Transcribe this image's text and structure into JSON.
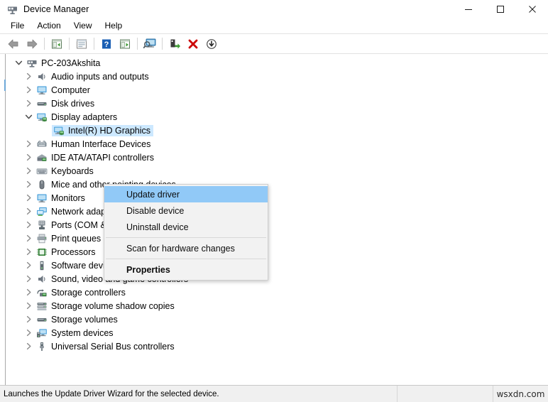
{
  "window": {
    "title": "Device Manager",
    "icon": "device-manager-icon",
    "minimize_label": "—",
    "maximize_label": "□",
    "close_label": "✕"
  },
  "menubar": {
    "items": [
      {
        "label": "File",
        "name": "menu-file"
      },
      {
        "label": "Action",
        "name": "menu-action"
      },
      {
        "label": "View",
        "name": "menu-view"
      },
      {
        "label": "Help",
        "name": "menu-help"
      }
    ]
  },
  "toolbar": {
    "buttons": [
      {
        "name": "back-button",
        "icon": "back-arrow-icon"
      },
      {
        "name": "forward-button",
        "icon": "forward-arrow-icon"
      },
      {
        "name": "show-hide-console-tree-button",
        "icon": "console-tree-icon"
      },
      {
        "name": "properties-button",
        "icon": "properties-window-icon"
      },
      {
        "name": "help-button",
        "icon": "question-mark-icon"
      },
      {
        "name": "scan-hardware-changes-button",
        "icon": "scan-list-icon"
      },
      {
        "name": "update-driver-button",
        "icon": "monitor-search-icon"
      },
      {
        "name": "enable-device-button",
        "icon": "enable-device-green-icon"
      },
      {
        "name": "uninstall-device-button",
        "icon": "red-x-icon"
      },
      {
        "name": "disable-device-button",
        "icon": "down-arrow-circle-icon"
      }
    ]
  },
  "tree": {
    "nodes": [
      {
        "label": "PC-203Akshita",
        "depth": 0,
        "state": "expanded",
        "icon": "computer-root-icon",
        "name": "tree-node-pc-203akshita"
      },
      {
        "label": "Audio inputs and outputs",
        "depth": 1,
        "state": "collapsed",
        "icon": "speaker-icon",
        "name": "tree-node-audio-inputs-and-outputs"
      },
      {
        "label": "Computer",
        "depth": 1,
        "state": "collapsed",
        "icon": "monitor-icon",
        "name": "tree-node-computer"
      },
      {
        "label": "Disk drives",
        "depth": 1,
        "state": "collapsed",
        "icon": "disk-drive-icon",
        "name": "tree-node-disk-drives"
      },
      {
        "label": "Display adapters",
        "depth": 1,
        "state": "expanded",
        "icon": "display-adapter-icon",
        "name": "tree-node-display-adapters"
      },
      {
        "label": "Intel(R) HD Graphics",
        "depth": 2,
        "state": "leaf",
        "icon": "display-adapter-icon",
        "name": "tree-node-intel-hd-graphics",
        "selected": true
      },
      {
        "label": "Human Interface Devices",
        "depth": 1,
        "state": "collapsed",
        "icon": "hid-icon",
        "name": "tree-node-human-interface-devices"
      },
      {
        "label": "IDE ATA/ATAPI controllers",
        "depth": 1,
        "state": "collapsed",
        "icon": "ide-controller-icon",
        "name": "tree-node-ide-ata-atapi-controllers"
      },
      {
        "label": "Keyboards",
        "depth": 1,
        "state": "collapsed",
        "icon": "keyboard-icon",
        "name": "tree-node-keyboards"
      },
      {
        "label": "Mice and other pointing devices",
        "depth": 1,
        "state": "collapsed",
        "icon": "mouse-icon",
        "name": "tree-node-mice-and-other-pointing-devices"
      },
      {
        "label": "Monitors",
        "depth": 1,
        "state": "collapsed",
        "icon": "monitor-icon",
        "name": "tree-node-monitors"
      },
      {
        "label": "Network adapters",
        "depth": 1,
        "state": "collapsed",
        "icon": "network-adapter-icon",
        "name": "tree-node-network-adapters"
      },
      {
        "label": "Ports (COM & LPT)",
        "depth": 1,
        "state": "collapsed",
        "icon": "port-icon",
        "name": "tree-node-ports-com-and-lpt"
      },
      {
        "label": "Print queues",
        "depth": 1,
        "state": "collapsed",
        "icon": "printer-icon",
        "name": "tree-node-print-queues"
      },
      {
        "label": "Processors",
        "depth": 1,
        "state": "collapsed",
        "icon": "processor-icon",
        "name": "tree-node-processors"
      },
      {
        "label": "Software devices",
        "depth": 1,
        "state": "collapsed",
        "icon": "software-device-icon",
        "name": "tree-node-software-devices"
      },
      {
        "label": "Sound, video and game controllers",
        "depth": 1,
        "state": "collapsed",
        "icon": "speaker-icon",
        "name": "tree-node-sound-video-and-game-controllers"
      },
      {
        "label": "Storage controllers",
        "depth": 1,
        "state": "collapsed",
        "icon": "storage-controller-icon",
        "name": "tree-node-storage-controllers"
      },
      {
        "label": "Storage volume shadow copies",
        "depth": 1,
        "state": "collapsed",
        "icon": "storage-stack-icon",
        "name": "tree-node-storage-volume-shadow-copies"
      },
      {
        "label": "Storage volumes",
        "depth": 1,
        "state": "collapsed",
        "icon": "disk-drive-icon",
        "name": "tree-node-storage-volumes"
      },
      {
        "label": "System devices",
        "depth": 1,
        "state": "collapsed",
        "icon": "system-device-icon",
        "name": "tree-node-system-devices"
      },
      {
        "label": "Universal Serial Bus controllers",
        "depth": 1,
        "state": "collapsed",
        "icon": "usb-icon",
        "name": "tree-node-universal-serial-bus-controllers"
      }
    ]
  },
  "context_menu": {
    "items": [
      {
        "label": "Update driver",
        "name": "context-menu-update-driver",
        "highlighted": true,
        "bold": false,
        "separator_after": false
      },
      {
        "label": "Disable device",
        "name": "context-menu-disable-device",
        "highlighted": false,
        "bold": false,
        "separator_after": false
      },
      {
        "label": "Uninstall device",
        "name": "context-menu-uninstall-device",
        "highlighted": false,
        "bold": false,
        "separator_after": true
      },
      {
        "label": "Scan for hardware changes",
        "name": "context-menu-scan-hardware-changes",
        "highlighted": false,
        "bold": false,
        "separator_after": true
      },
      {
        "label": "Properties",
        "name": "context-menu-properties",
        "highlighted": false,
        "bold": true,
        "separator_after": false
      }
    ]
  },
  "statusbar": {
    "message": "Launches the Update Driver Wizard for the selected device.",
    "watermark": "wsxdn.com"
  },
  "colors": {
    "selection_blue": "#cce8ff",
    "menu_highlight": "#91c9f7",
    "menu_bg": "#f2f2f2",
    "status_bg": "#f0f0f0",
    "accent_red": "#cc0000",
    "accent_green": "#3f9c35"
  }
}
